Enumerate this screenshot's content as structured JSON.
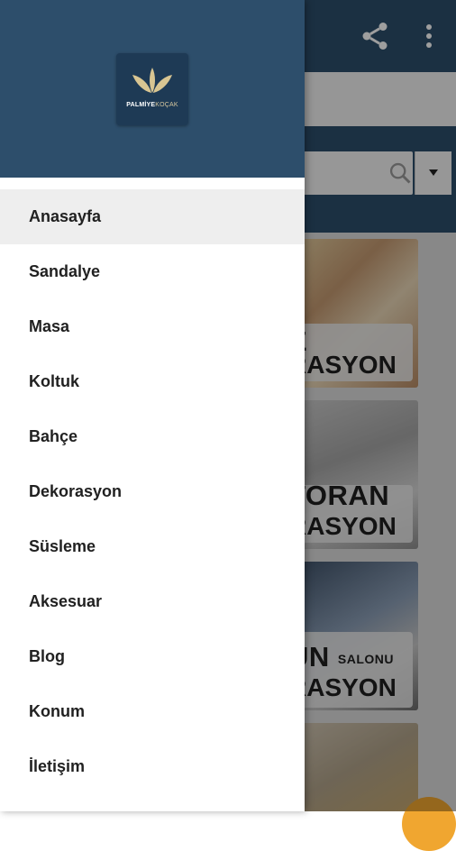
{
  "background": {
    "banners": [
      {
        "line1": "E",
        "line2": "RASYON"
      },
      {
        "line1": "TORAN",
        "line2": "RASYON"
      },
      {
        "line1": "ÜN",
        "line1_small": "SALONU",
        "line2": "RASYON"
      },
      {
        "line1": "",
        "line2": ""
      }
    ]
  },
  "drawer": {
    "logo": {
      "brand": "PALMİYE",
      "brand_suffix": "KOÇAK"
    },
    "menu": [
      {
        "label": "Anasayfa",
        "active": true
      },
      {
        "label": "Sandalye",
        "active": false
      },
      {
        "label": "Masa",
        "active": false
      },
      {
        "label": "Koltuk",
        "active": false
      },
      {
        "label": "Bahçe",
        "active": false
      },
      {
        "label": "Dekorasyon",
        "active": false
      },
      {
        "label": "Süsleme",
        "active": false
      },
      {
        "label": "Aksesuar",
        "active": false
      },
      {
        "label": "Blog",
        "active": false
      },
      {
        "label": "Konum",
        "active": false
      },
      {
        "label": "İletişim",
        "active": false
      }
    ]
  },
  "colors": {
    "primary": "#2d4e6b",
    "drawer_bg": "#ffffff",
    "active_item_bg": "#eeeeee",
    "fab": "#f0a630"
  }
}
